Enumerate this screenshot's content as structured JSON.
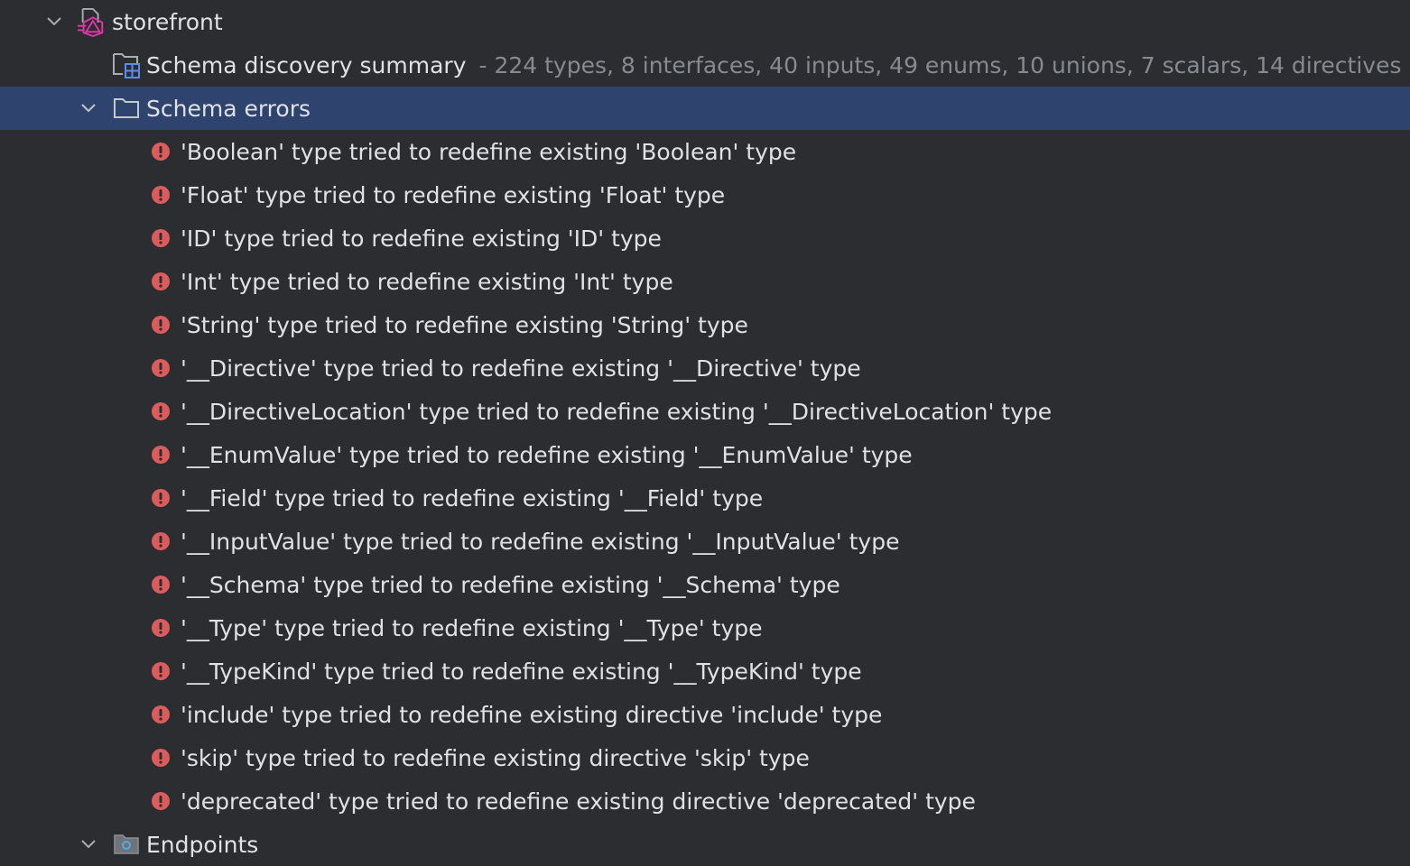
{
  "tree": {
    "root": {
      "label": "storefront",
      "icon": "graphql-project-icon"
    },
    "summary": {
      "label": "Schema discovery summary",
      "hint": "- 224 types, 8 interfaces, 40 inputs, 49 enums, 10 unions, 7 scalars, 14 directives",
      "icon": "schema-summary-icon"
    },
    "errors_folder": {
      "label": "Schema errors",
      "icon": "folder-icon"
    },
    "errors": [
      "'Boolean' type tried to redefine existing 'Boolean' type",
      "'Float' type tried to redefine existing 'Float' type",
      "'ID' type tried to redefine existing 'ID' type",
      "'Int' type tried to redefine existing 'Int' type",
      "'String' type tried to redefine existing 'String' type",
      "'__Directive' type tried to redefine existing '__Directive' type",
      "'__DirectiveLocation' type tried to redefine existing '__DirectiveLocation' type",
      "'__EnumValue' type tried to redefine existing '__EnumValue' type",
      "'__Field' type tried to redefine existing '__Field' type",
      "'__InputValue' type tried to redefine existing '__InputValue' type",
      "'__Schema' type tried to redefine existing '__Schema' type",
      "'__Type' type tried to redefine existing '__Type' type",
      "'__TypeKind' type tried to redefine existing '__TypeKind' type",
      "'include' type tried to redefine existing directive 'include' type",
      "'skip' type tried to redefine existing directive 'skip' type",
      "'deprecated' type tried to redefine existing directive 'deprecated' type"
    ],
    "endpoints": {
      "label": "Endpoints",
      "icon": "endpoints-folder-icon"
    }
  },
  "colors": {
    "background": "#2b2d30",
    "selection": "#2e436e",
    "text": "#dfe1e5",
    "hint": "#868a91",
    "error": "#db5c5c",
    "accent": "#e535ab"
  }
}
